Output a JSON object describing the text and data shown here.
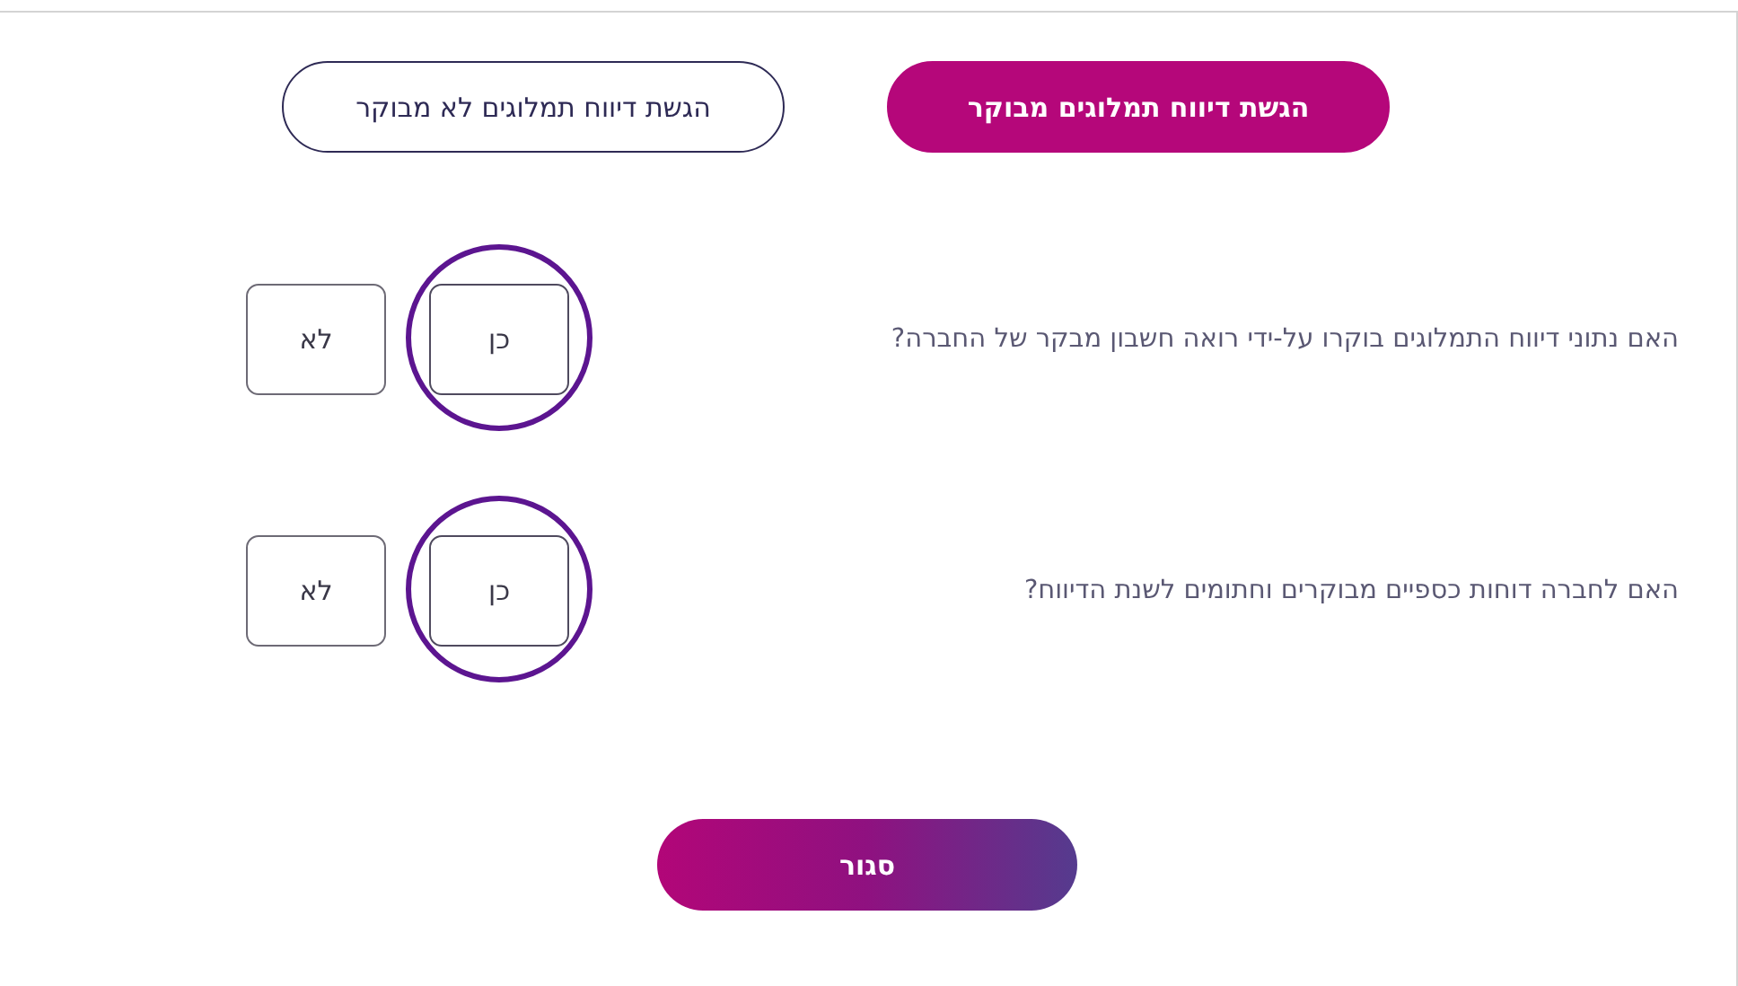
{
  "tabs": [
    {
      "label": "הגשת דיווח תמלוגים מבוקר",
      "selected": true
    },
    {
      "label": "הגשת דיווח תמלוגים לא מבוקר",
      "selected": false
    }
  ],
  "questions": [
    {
      "text": "האם נתוני דיווח התמלוגים בוקרו על-ידי רואה חשבון מבקר של החברה?",
      "answers": [
        {
          "label": "כן",
          "selected": true
        },
        {
          "label": "לא",
          "selected": false
        }
      ]
    },
    {
      "text": "האם לחברה דוחות כספיים מבוקרים וחתומים לשנת הדיווח?",
      "answers": [
        {
          "label": "כן",
          "selected": true
        },
        {
          "label": "לא",
          "selected": false
        }
      ]
    }
  ],
  "close_button": "סגור"
}
